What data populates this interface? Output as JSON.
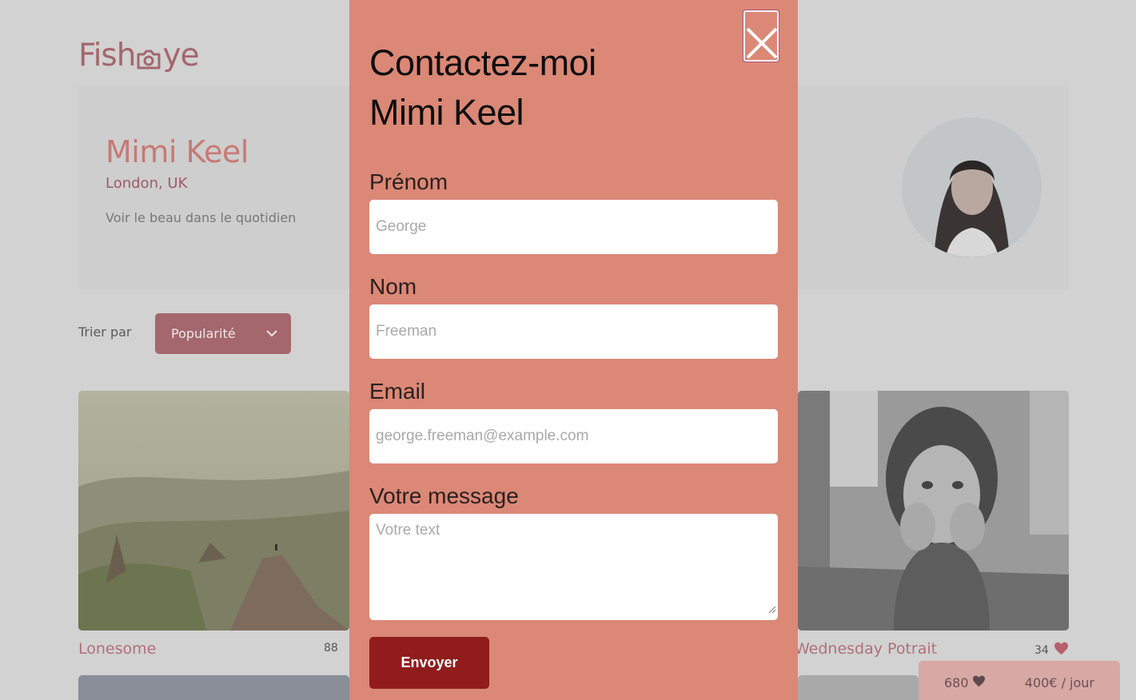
{
  "brand": {
    "logo_left": "Fish",
    "logo_right": "ye"
  },
  "photographer": {
    "name": "Mimi Keel",
    "location": "London, UK",
    "tagline": "Voir le beau dans le quotidien"
  },
  "sort": {
    "label": "Trier par",
    "selected": "Popularité"
  },
  "media": [
    {
      "title": "Lonesome",
      "likes": "88"
    },
    {
      "title": "Wednesday Potrait",
      "likes": "34"
    }
  ],
  "info_box": {
    "total_likes": "680",
    "price": "400€ / jour"
  },
  "modal": {
    "title_line1": "Contactez-moi",
    "title_line2": "Mimi Keel",
    "fields": {
      "first_name": {
        "label": "Prénom",
        "placeholder": "George"
      },
      "last_name": {
        "label": "Nom",
        "placeholder": "Freeman"
      },
      "email": {
        "label": "Email",
        "placeholder": "george.freeman@example.com"
      },
      "message": {
        "label": "Votre message",
        "placeholder": "Votre text"
      }
    },
    "submit_label": "Envoyer"
  },
  "colors": {
    "brand": "#a3676d",
    "modal_bg": "#db8876",
    "submit_bg": "#901c1c",
    "overlay": "#d2d2d2"
  }
}
